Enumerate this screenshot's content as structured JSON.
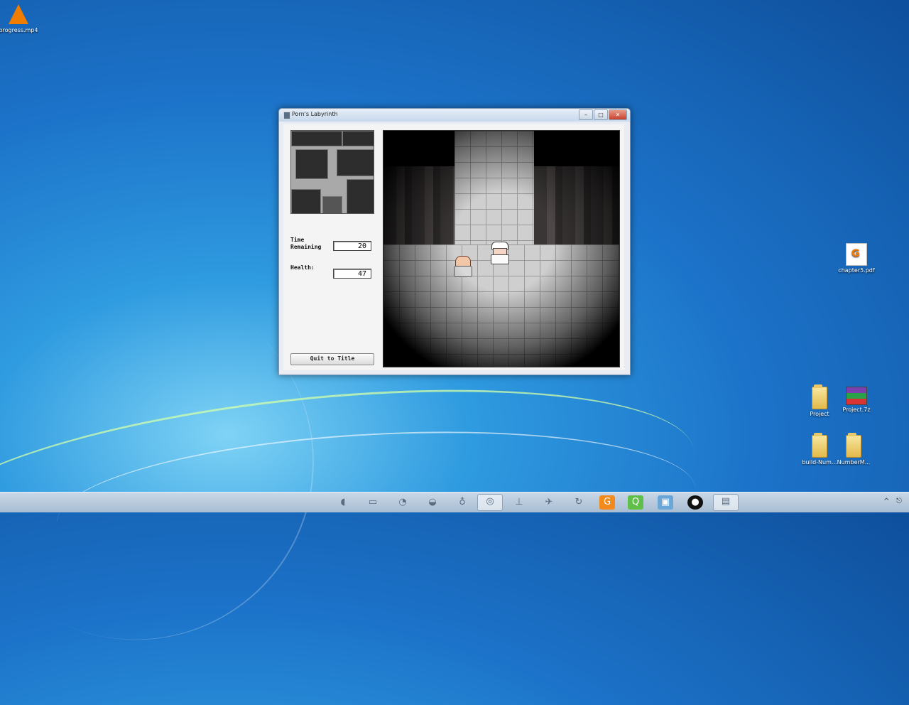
{
  "desktop": {
    "icons": [
      {
        "label": "progress.mp4",
        "type": "vlc"
      },
      {
        "label": "chapter5.pdf",
        "type": "pdf"
      },
      {
        "label": "Project",
        "type": "folder"
      },
      {
        "label": "Project.7z",
        "type": "archive"
      },
      {
        "label": "build-Num...",
        "type": "folder"
      },
      {
        "label": "NumberM...",
        "type": "folder"
      }
    ]
  },
  "window": {
    "title": "Porn's Labyrinth",
    "controls": {
      "minimize": "–",
      "maximize": "□",
      "close": "✕"
    },
    "time_label": "Time\nRemaining",
    "time_value": "20",
    "health_label": "Health:",
    "health_value": "47",
    "quit_label": "Quit to Title"
  },
  "taskbar": {
    "tray_icons": [
      "^",
      "⎋"
    ]
  },
  "colors": {
    "desktop_blue": "#1c73c9",
    "close_red": "#c6412b"
  }
}
